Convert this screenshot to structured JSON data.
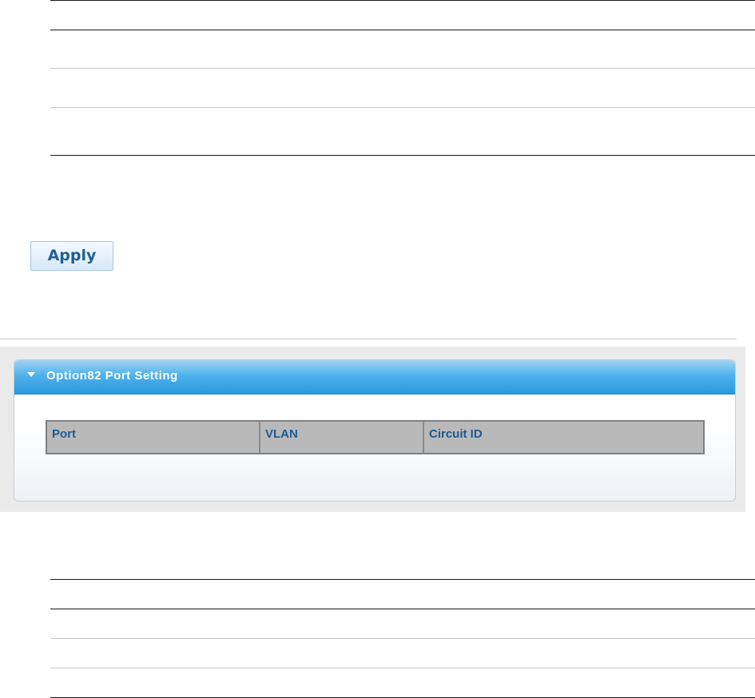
{
  "actions": {
    "apply_label": "Apply"
  },
  "option82_port_setting": {
    "title": "Option82 Port Setting",
    "columns": [
      "Port",
      "VLAN",
      "Circuit ID"
    ]
  }
}
